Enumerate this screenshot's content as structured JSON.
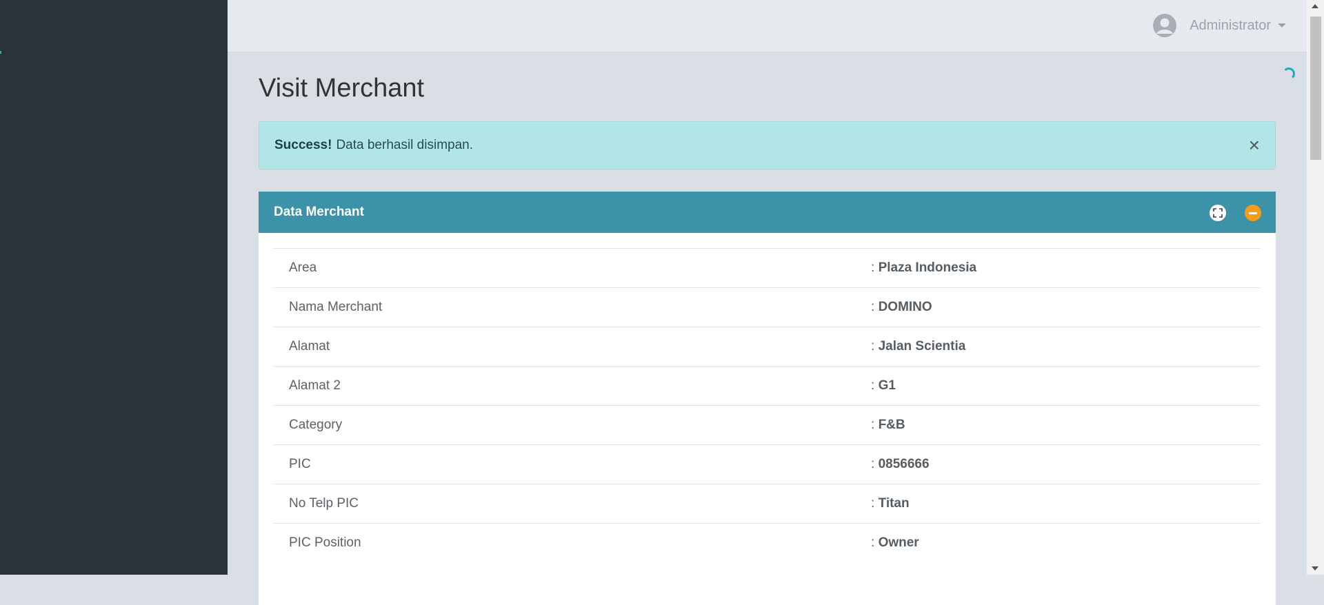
{
  "header": {
    "user_name": "Administrator",
    "user_icon": "user-avatar-icon",
    "caret_icon": "caret-down-icon"
  },
  "page": {
    "title": "Visit Merchant"
  },
  "alert": {
    "strong": "Success!",
    "message": "Data berhasil disimpan.",
    "close": "×"
  },
  "panel": {
    "title": "Data Merchant",
    "rows": [
      {
        "label": "Area",
        "value": ": ",
        "bold": "Plaza Indonesia"
      },
      {
        "label": "Nama Merchant",
        "value": ": ",
        "bold": "DOMINO"
      },
      {
        "label": "Alamat",
        "value": ": ",
        "bold": "Jalan Scientia"
      },
      {
        "label": "Alamat 2",
        "value": ": ",
        "bold": "G1"
      },
      {
        "label": "Category",
        "value": ": ",
        "bold": "F&B"
      },
      {
        "label": "PIC",
        "value": ": ",
        "bold": "0856666"
      },
      {
        "label": "No Telp PIC",
        "value": ": ",
        "bold": "Titan"
      },
      {
        "label": "PIC Position",
        "value": ": ",
        "bold": "Owner"
      }
    ]
  },
  "colors": {
    "sidebar": "#2a323a",
    "panel_header": "#3b92a9",
    "alert_bg": "#b2e5e6",
    "collapse_button": "#f59c1a"
  }
}
